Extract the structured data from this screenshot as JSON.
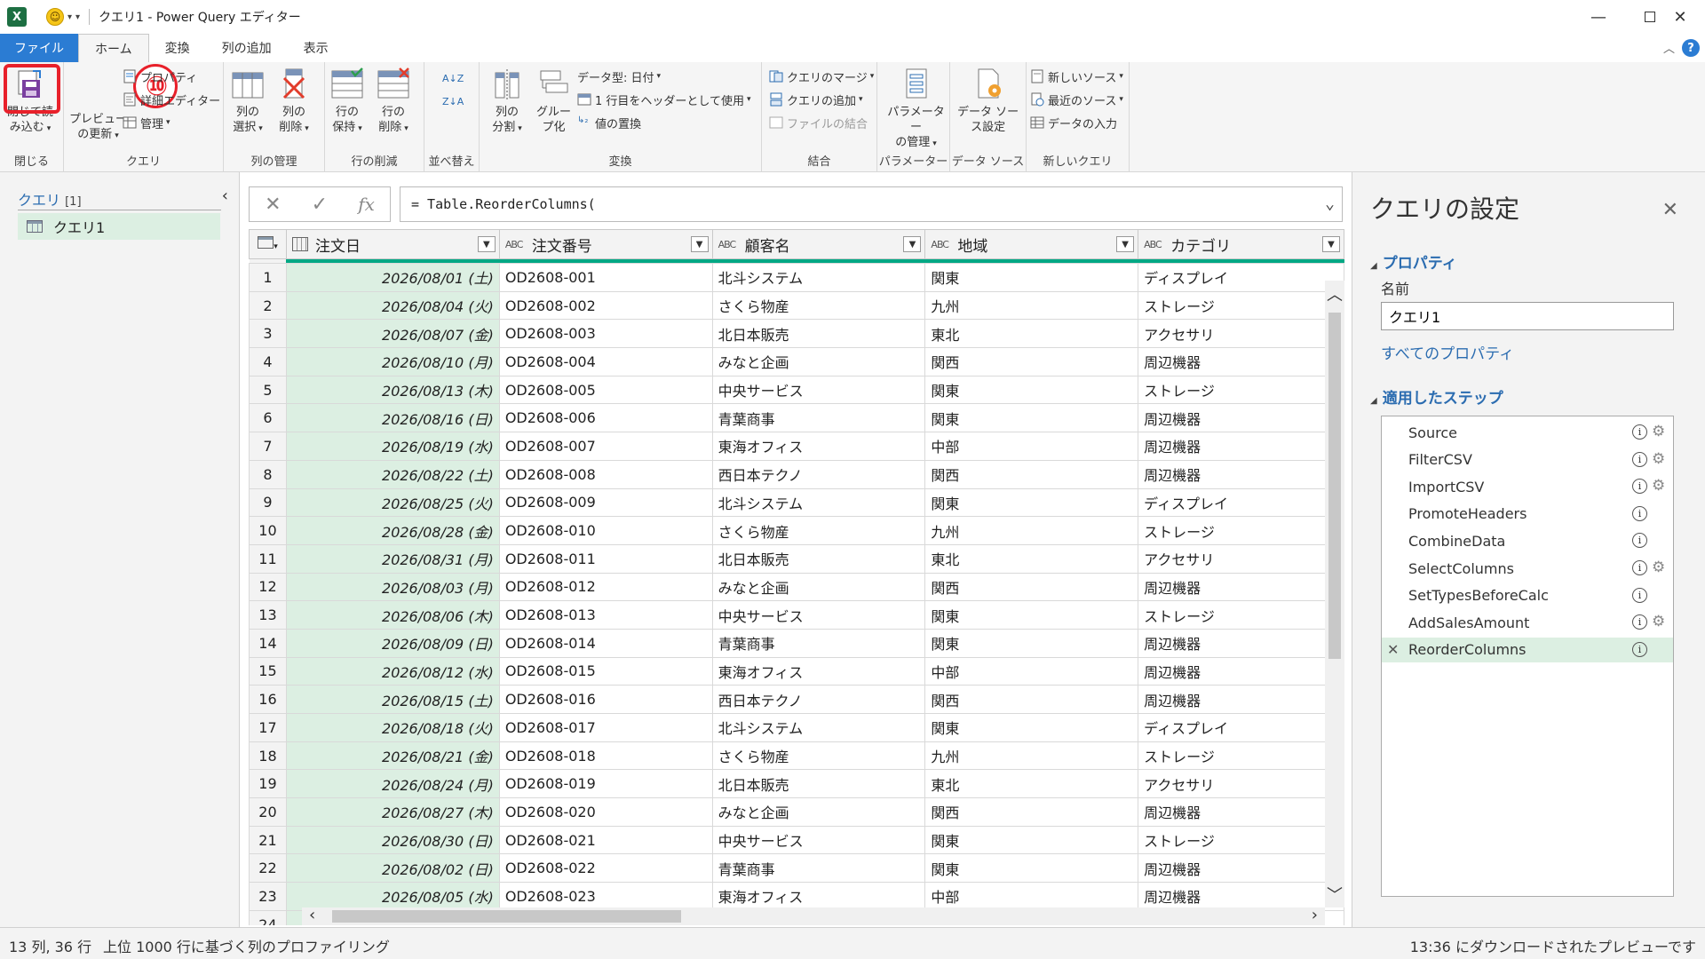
{
  "window": {
    "title": "クエリ1 - Power Query エディター",
    "app_icon": "excel-icon",
    "qat_icon": "smiley-icon",
    "min_glyph": "—",
    "max_glyph": "☐",
    "close_glyph": "✕"
  },
  "tabs": [
    {
      "label": "ファイル"
    },
    {
      "label": "ホーム"
    },
    {
      "label": "変換"
    },
    {
      "label": "列の追加"
    },
    {
      "label": "表示"
    }
  ],
  "ribbon": {
    "close_group": {
      "label": "閉じる",
      "close_load_line1": "閉じて読",
      "close_load_line2": "み込む",
      "step_badge": "⑩"
    },
    "query_group": {
      "label": "クエリ",
      "preview_line1": "プレビュー",
      "preview_line2": "の更新",
      "properties": "プロパティ",
      "advanced_editor": "詳細エディター",
      "manage": "管理"
    },
    "columns_group": {
      "label": "列の管理",
      "choose_line1": "列の",
      "choose_line2": "選択",
      "remove_line1": "列の",
      "remove_line2": "削除"
    },
    "rows_group": {
      "label": "行の削減",
      "keep_line1": "行の",
      "keep_line2": "保持",
      "remove_line1": "行の",
      "remove_line2": "削除"
    },
    "sort_group": {
      "label": "並べ替え",
      "asc": "A↓Z",
      "desc": "Z↓A"
    },
    "transform_group": {
      "label": "変換",
      "split_line1": "列の",
      "split_line2": "分割",
      "group_line1": "グルー",
      "group_line2": "プ化",
      "data_type": "データ型: 日付",
      "use_header": "1 行目をヘッダーとして使用",
      "replace": "値の置換"
    },
    "combine_group": {
      "label": "結合",
      "merge": "クエリのマージ",
      "append": "クエリの追加",
      "combine_files": "ファイルの結合"
    },
    "param_group": {
      "label": "パラメーター",
      "manage_line1": "パラメーター",
      "manage_line2": "の管理"
    },
    "datasource_group": {
      "label": "データ ソース",
      "settings_line1": "データ ソー",
      "settings_line2": "ス設定"
    },
    "newquery_group": {
      "label": "新しいクエリ",
      "new_source": "新しいソース",
      "recent_source": "最近のソース",
      "enter_data": "データの入力"
    }
  },
  "query_pane": {
    "header": "クエリ",
    "count": "[1]",
    "items": [
      {
        "label": "クエリ1"
      }
    ]
  },
  "formula_bar": {
    "cancel": "✕",
    "confirm": "✓",
    "fx": "fx",
    "formula": "= Table.ReorderColumns("
  },
  "grid": {
    "columns": [
      {
        "name": "注文日",
        "type": "date"
      },
      {
        "name": "注文番号",
        "type": "ABC"
      },
      {
        "name": "顧客名",
        "type": "ABC"
      },
      {
        "name": "地域",
        "type": "ABC"
      },
      {
        "name": "カテゴリ",
        "type": "ABC"
      }
    ],
    "rows": [
      [
        "1",
        "2026/08/01 (土)",
        "OD2608-001",
        "北斗システム",
        "関東",
        "ディスプレイ"
      ],
      [
        "2",
        "2026/08/04 (火)",
        "OD2608-002",
        "さくら物産",
        "九州",
        "ストレージ"
      ],
      [
        "3",
        "2026/08/07 (金)",
        "OD2608-003",
        "北日本販売",
        "東北",
        "アクセサリ"
      ],
      [
        "4",
        "2026/08/10 (月)",
        "OD2608-004",
        "みなと企画",
        "関西",
        "周辺機器"
      ],
      [
        "5",
        "2026/08/13 (木)",
        "OD2608-005",
        "中央サービス",
        "関東",
        "ストレージ"
      ],
      [
        "6",
        "2026/08/16 (日)",
        "OD2608-006",
        "青葉商事",
        "関東",
        "周辺機器"
      ],
      [
        "7",
        "2026/08/19 (水)",
        "OD2608-007",
        "東海オフィス",
        "中部",
        "周辺機器"
      ],
      [
        "8",
        "2026/08/22 (土)",
        "OD2608-008",
        "西日本テクノ",
        "関西",
        "周辺機器"
      ],
      [
        "9",
        "2026/08/25 (火)",
        "OD2608-009",
        "北斗システム",
        "関東",
        "ディスプレイ"
      ],
      [
        "10",
        "2026/08/28 (金)",
        "OD2608-010",
        "さくら物産",
        "九州",
        "ストレージ"
      ],
      [
        "11",
        "2026/08/31 (月)",
        "OD2608-011",
        "北日本販売",
        "東北",
        "アクセサリ"
      ],
      [
        "12",
        "2026/08/03 (月)",
        "OD2608-012",
        "みなと企画",
        "関西",
        "周辺機器"
      ],
      [
        "13",
        "2026/08/06 (木)",
        "OD2608-013",
        "中央サービス",
        "関東",
        "ストレージ"
      ],
      [
        "14",
        "2026/08/09 (日)",
        "OD2608-014",
        "青葉商事",
        "関東",
        "周辺機器"
      ],
      [
        "15",
        "2026/08/12 (水)",
        "OD2608-015",
        "東海オフィス",
        "中部",
        "周辺機器"
      ],
      [
        "16",
        "2026/08/15 (土)",
        "OD2608-016",
        "西日本テクノ",
        "関西",
        "周辺機器"
      ],
      [
        "17",
        "2026/08/18 (火)",
        "OD2608-017",
        "北斗システム",
        "関東",
        "ディスプレイ"
      ],
      [
        "18",
        "2026/08/21 (金)",
        "OD2608-018",
        "さくら物産",
        "九州",
        "ストレージ"
      ],
      [
        "19",
        "2026/08/24 (月)",
        "OD2608-019",
        "北日本販売",
        "東北",
        "アクセサリ"
      ],
      [
        "20",
        "2026/08/27 (木)",
        "OD2608-020",
        "みなと企画",
        "関西",
        "周辺機器"
      ],
      [
        "21",
        "2026/08/30 (日)",
        "OD2608-021",
        "中央サービス",
        "関東",
        "ストレージ"
      ],
      [
        "22",
        "2026/08/02 (日)",
        "OD2608-022",
        "青葉商事",
        "関東",
        "周辺機器"
      ],
      [
        "23",
        "2026/08/05 (水)",
        "OD2608-023",
        "東海オフィス",
        "中部",
        "周辺機器"
      ],
      [
        "24",
        "",
        "",
        "",
        "",
        ""
      ]
    ]
  },
  "settings": {
    "title": "クエリの設定",
    "properties_header": "プロパティ",
    "name_label": "名前",
    "name_value": "クエリ1",
    "all_properties": "すべてのプロパティ",
    "steps_header": "適用したステップ",
    "steps": [
      {
        "name": "Source",
        "gear": true
      },
      {
        "name": "FilterCSV",
        "gear": true
      },
      {
        "name": "ImportCSV",
        "gear": true
      },
      {
        "name": "PromoteHeaders",
        "gear": false
      },
      {
        "name": "CombineData",
        "gear": false
      },
      {
        "name": "SelectColumns",
        "gear": true
      },
      {
        "name": "SetTypesBeforeCalc",
        "gear": false
      },
      {
        "name": "AddSalesAmount",
        "gear": true
      },
      {
        "name": "ReorderColumns",
        "gear": false,
        "selected": true
      }
    ]
  },
  "status": {
    "left": "13 列, 36 行",
    "profiling": "上位 1000 行に基づく列のプロファイリング",
    "right": "13:36 にダウンロードされたプレビューです"
  },
  "colors": {
    "accent": "#2b7cd3",
    "selection_green": "#dcefe2",
    "quality_bar": "#00a884",
    "highlight_red": "#e8202a"
  }
}
